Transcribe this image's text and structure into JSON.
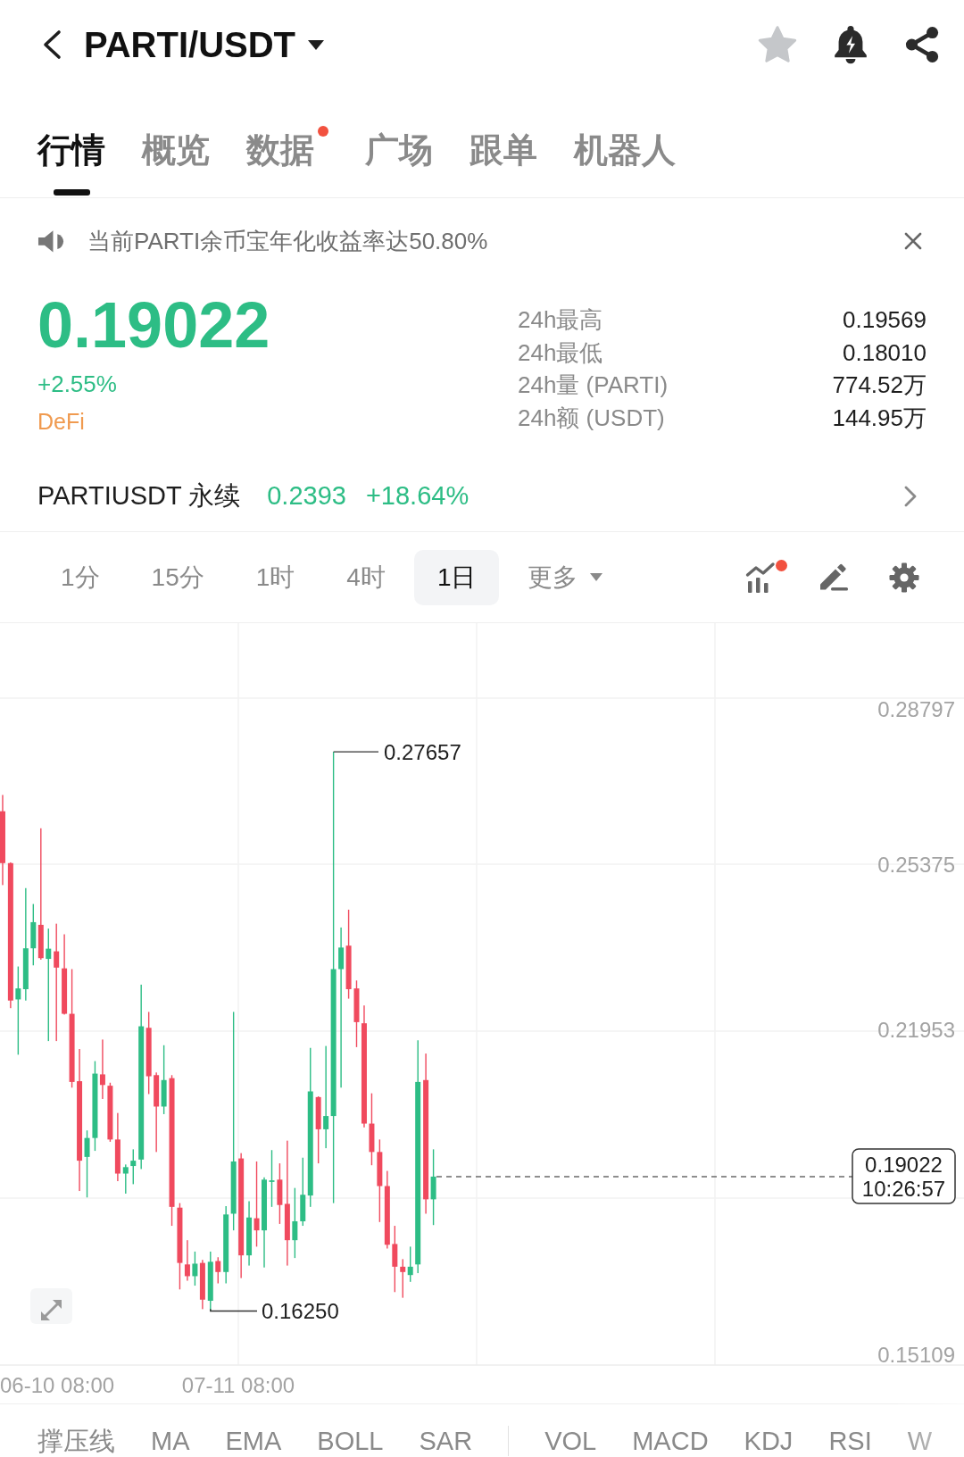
{
  "header": {
    "title": "PARTI/USDT",
    "favorited": false
  },
  "tabs": [
    {
      "label": "行情",
      "selected": true,
      "dot": false
    },
    {
      "label": "概览",
      "selected": false,
      "dot": false
    },
    {
      "label": "数据",
      "selected": false,
      "dot": true
    },
    {
      "label": "广场",
      "selected": false,
      "dot": false
    },
    {
      "label": "跟单",
      "selected": false,
      "dot": false
    },
    {
      "label": "机器人",
      "selected": false,
      "dot": false
    }
  ],
  "notice": {
    "text": "当前PARTI余币宝年化收益率达50.80%"
  },
  "ticker": {
    "price": "0.19022",
    "change": "+2.55%",
    "rising": true,
    "sector": "DeFi",
    "stats": [
      {
        "label": "24h最高",
        "value": "0.19569"
      },
      {
        "label": "24h最低",
        "value": "0.18010"
      },
      {
        "label": "24h量 (PARTI)",
        "value": "774.52万"
      },
      {
        "label": "24h额 (USDT)",
        "value": "144.95万"
      }
    ]
  },
  "perpetual": {
    "name": "PARTIUSDT 永续",
    "price": "0.2393",
    "change": "+18.64%",
    "rising": true
  },
  "timeframes": [
    {
      "label": "1分",
      "selected": false
    },
    {
      "label": "15分",
      "selected": false
    },
    {
      "label": "1时",
      "selected": false
    },
    {
      "label": "4时",
      "selected": false
    },
    {
      "label": "1日",
      "selected": true
    }
  ],
  "more_timeframes": {
    "label": "更多"
  },
  "chart_tools": [
    {
      "kind": "indicators",
      "dot": true
    },
    {
      "kind": "draw",
      "dot": false
    },
    {
      "kind": "settings",
      "dot": false
    }
  ],
  "chart": {
    "price_axis": [
      "0.28797",
      "0.25375",
      "0.21953",
      "0.15109"
    ],
    "time_axis": [
      "06-10 08:00",
      "07-11 08:00"
    ],
    "high_marker": "0.27657",
    "low_marker": "0.16250",
    "last_price": "0.19022",
    "last_time": "10:26:57"
  },
  "indicators": {
    "main": [
      "撑压线",
      "MA",
      "EMA",
      "BOLL",
      "SAR"
    ],
    "sub": [
      "VOL",
      "MACD",
      "KDJ",
      "RSI",
      "W"
    ]
  }
}
